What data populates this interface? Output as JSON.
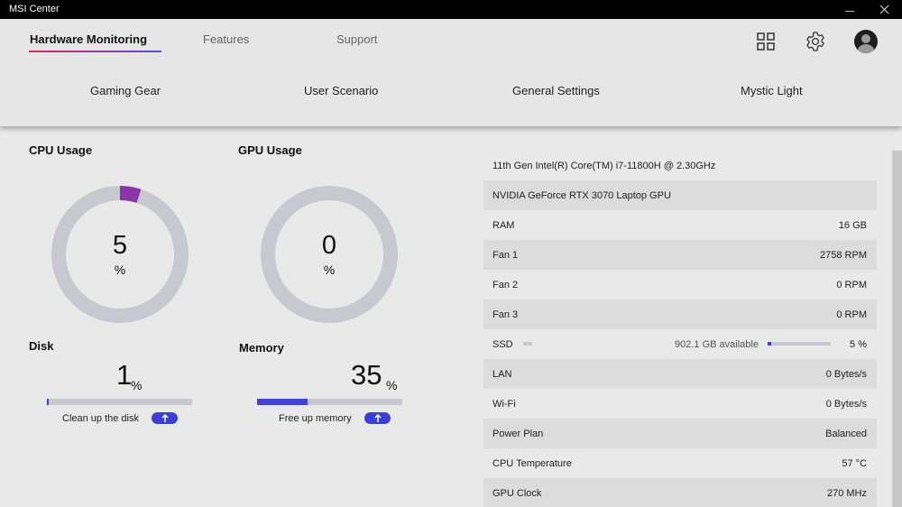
{
  "window": {
    "title": "MSI Center"
  },
  "tabs": [
    {
      "label": "Hardware Monitoring",
      "active": true
    },
    {
      "label": "Features",
      "active": false
    },
    {
      "label": "Support",
      "active": false
    }
  ],
  "header_icons": [
    "grid-icon",
    "gear-icon",
    "avatar-icon"
  ],
  "subnav": [
    "Gaming Gear",
    "User Scenario",
    "General Settings",
    "Mystic Light"
  ],
  "cpu": {
    "title": "CPU Usage",
    "value": "5",
    "unit": "%",
    "percent": 5
  },
  "gpu": {
    "title": "GPU Usage",
    "value": "0",
    "unit": "%",
    "percent": 0
  },
  "disk": {
    "title": "Disk",
    "value": "1",
    "unit": "%",
    "percent": 1,
    "action": "Clean up the disk"
  },
  "memory": {
    "title": "Memory",
    "value": "35",
    "unit": "%",
    "percent": 35,
    "action": "Free up memory"
  },
  "info": {
    "cpu_name": "11th Gen Intel(R) Core(TM) i7-11800H @ 2.30GHz",
    "gpu_name": "NVIDIA GeForce RTX 3070 Laptop GPU",
    "rows": [
      {
        "label": "RAM",
        "value": "16 GB"
      },
      {
        "label": "Fan 1",
        "value": "2758 RPM"
      },
      {
        "label": "Fan 2",
        "value": "0 RPM"
      },
      {
        "label": "Fan 3",
        "value": "0 RPM"
      }
    ],
    "ssd": {
      "label": "SSD",
      "available": "902.1 GB available",
      "value": "5 %",
      "percent": 5
    },
    "rows2": [
      {
        "label": "LAN",
        "value": "0 Bytes/s"
      },
      {
        "label": "Wi-Fi",
        "value": "0 Bytes/s"
      },
      {
        "label": "Power Plan",
        "value": "Balanced"
      },
      {
        "label": "CPU Temperature",
        "value": "57 °C"
      },
      {
        "label": "GPU Clock",
        "value": "270 MHz"
      }
    ]
  },
  "colors": {
    "accent": "#3d45d8",
    "cpu_arc": "#8b35a8",
    "track": "#c7c9d0",
    "tab_gradient_start": "#e0245e",
    "tab_gradient_end": "#5a4bd6"
  }
}
